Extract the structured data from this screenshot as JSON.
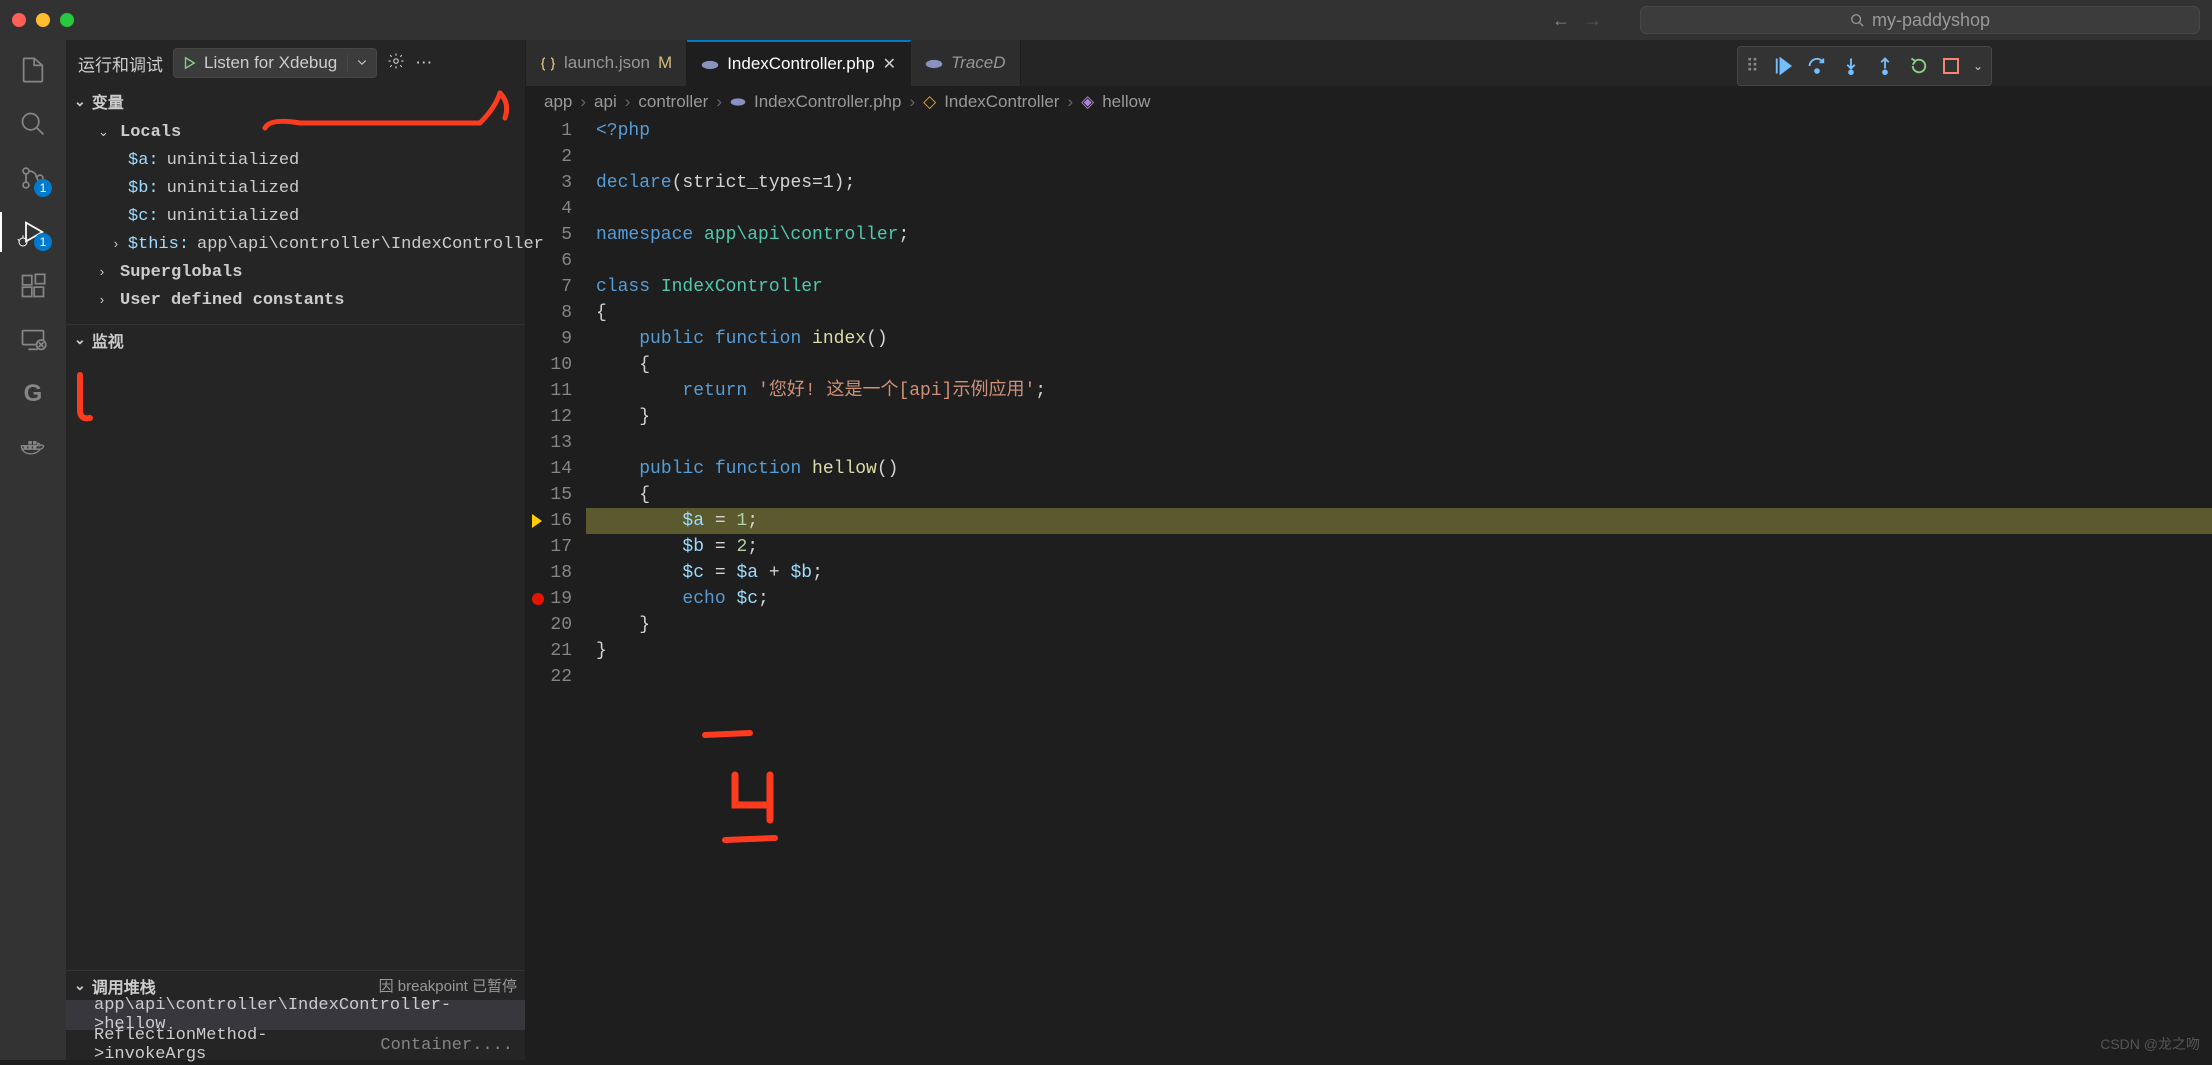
{
  "titleBar": {
    "searchPlaceholder": "my-paddyshop"
  },
  "activityBar": {
    "scmBadge": "1",
    "debugBadge": "1"
  },
  "debugPanel": {
    "headerLabel": "运行和调试",
    "configName": "Listen for Xdebug",
    "sections": {
      "variables": "变量",
      "watch": "监视",
      "callstack": "调用堆栈"
    },
    "callstackStatus": "因 breakpoint 已暂停",
    "localsLabel": "Locals",
    "locals": [
      {
        "name": "$a:",
        "value": "uninitialized"
      },
      {
        "name": "$b:",
        "value": "uninitialized"
      },
      {
        "name": "$c:",
        "value": "uninitialized"
      }
    ],
    "thisRow": {
      "name": "$this:",
      "value": "app\\api\\controller\\IndexController"
    },
    "superglobalsLabel": "Superglobals",
    "userConstantsLabel": "User defined constants",
    "callstack": [
      {
        "fn": "app\\api\\controller\\IndexController->hellow",
        "file": ""
      },
      {
        "fn": "ReflectionMethod->invokeArgs",
        "file": "Container...."
      }
    ]
  },
  "tabs": {
    "launch": {
      "label": "launch.json",
      "modifiedMark": "M"
    },
    "index": {
      "label": "IndexController.php"
    },
    "trace": {
      "label": "TraceD"
    }
  },
  "breadcrumbs": {
    "p1": "app",
    "p2": "api",
    "p3": "controller",
    "p4": "IndexController.php",
    "p5": "IndexController",
    "p6": "hellow"
  },
  "code": {
    "lines": {
      "l1a": "<?php",
      "l3_declare": "declare",
      "l3_rest": "(strict_types=1);",
      "l5_ns": "namespace",
      "l5_path": " app\\api\\controller",
      "l5_semi": ";",
      "l7_class": "class",
      "l7_name": " IndexController",
      "l8": "{",
      "l9_pub": "public",
      "l9_fn": " function",
      "l9_name": " index",
      "l9_paren": "()",
      "l10": "{",
      "l11_ret": "return",
      "l11_str": " '您好! 这是一个[api]示例应用'",
      "l11_semi": ";",
      "l12": "}",
      "l14_pub": "public",
      "l14_fn": " function",
      "l14_name": " hellow",
      "l14_paren": "()",
      "l15": "{",
      "l16_a": "$a",
      "l16_eq": " = ",
      "l16_v": "1",
      "l16_s": ";",
      "l17_a": "$b",
      "l17_eq": " = ",
      "l17_v": "2",
      "l17_s": ";",
      "l18_a": "$c",
      "l18_eq": " = ",
      "l18_b": "$a",
      "l18_plus": " + ",
      "l18_c": "$b",
      "l18_s": ";",
      "l19_echo": "echo",
      "l19_v": " $c",
      "l19_s": ";",
      "l20": "}",
      "l21": "}"
    }
  },
  "watermark": "CSDN @龙之吻"
}
